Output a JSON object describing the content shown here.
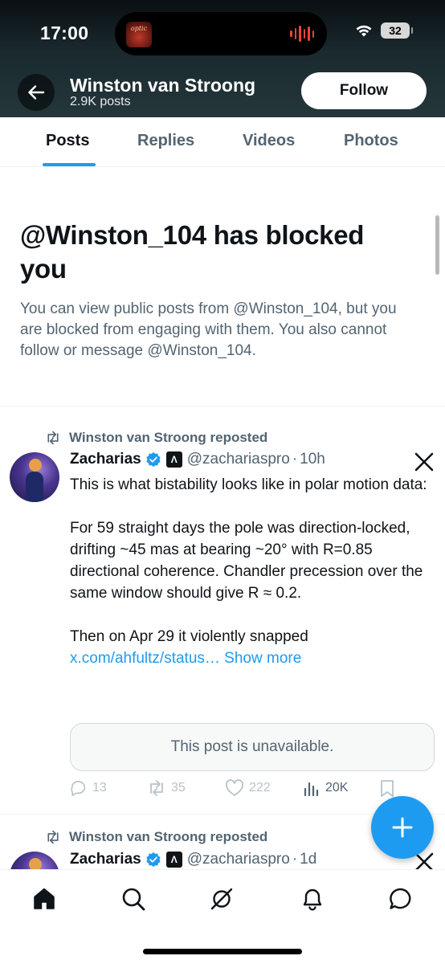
{
  "status_bar": {
    "time": "17:00",
    "island_art_text": "optic",
    "battery": "32"
  },
  "header": {
    "back_icon": "arrow-left-icon",
    "name": "Winston van Stroong",
    "posts_count": "2.9K posts",
    "follow_label": "Follow"
  },
  "tabs": [
    {
      "label": "Posts",
      "active": true
    },
    {
      "label": "Replies",
      "active": false
    },
    {
      "label": "Videos",
      "active": false
    },
    {
      "label": "Photos",
      "active": false
    }
  ],
  "blocked": {
    "title": "@Winston_104 has blocked you",
    "body": "You can view public posts from @Winston_104, but you are blocked from engaging with them. You also cannot follow or message @Winston_104."
  },
  "posts": [
    {
      "repost_label": "Winston van Stroong reposted",
      "author": "Zacharias",
      "affiliate_badge": "Λ",
      "handle": "@zachariaspro",
      "dot": "·",
      "time": "10h",
      "paragraphs": [
        "This is what bistability looks like in polar motion data:",
        "For 59 straight days the pole was direction-locked, drifting ~45 mas at bearing ~20° with R=0.85 directional coherence. Chandler precession over the same window should give R ≈ 0.2."
      ],
      "last_paragraph_text": "Then on Apr 29 it violently snapped ",
      "link_text": "x.com/ahfultz/status…",
      "show_more": " Show more",
      "quoted_unavailable": "This post is unavailable.",
      "replies": "13",
      "reposts": "35",
      "likes": "222",
      "views": "20K"
    },
    {
      "repost_label": "Winston van Stroong reposted",
      "author": "Zacharias",
      "affiliate_badge": "Λ",
      "handle": "@zachariaspro",
      "dot": "·",
      "time": "1d"
    }
  ],
  "colors": {
    "accent": "#1d9bf0",
    "text_primary": "#0f1419",
    "text_secondary": "#536471"
  },
  "bottom_nav": [
    "home-icon",
    "search-icon",
    "grok-icon",
    "notifications-icon",
    "messages-icon"
  ]
}
